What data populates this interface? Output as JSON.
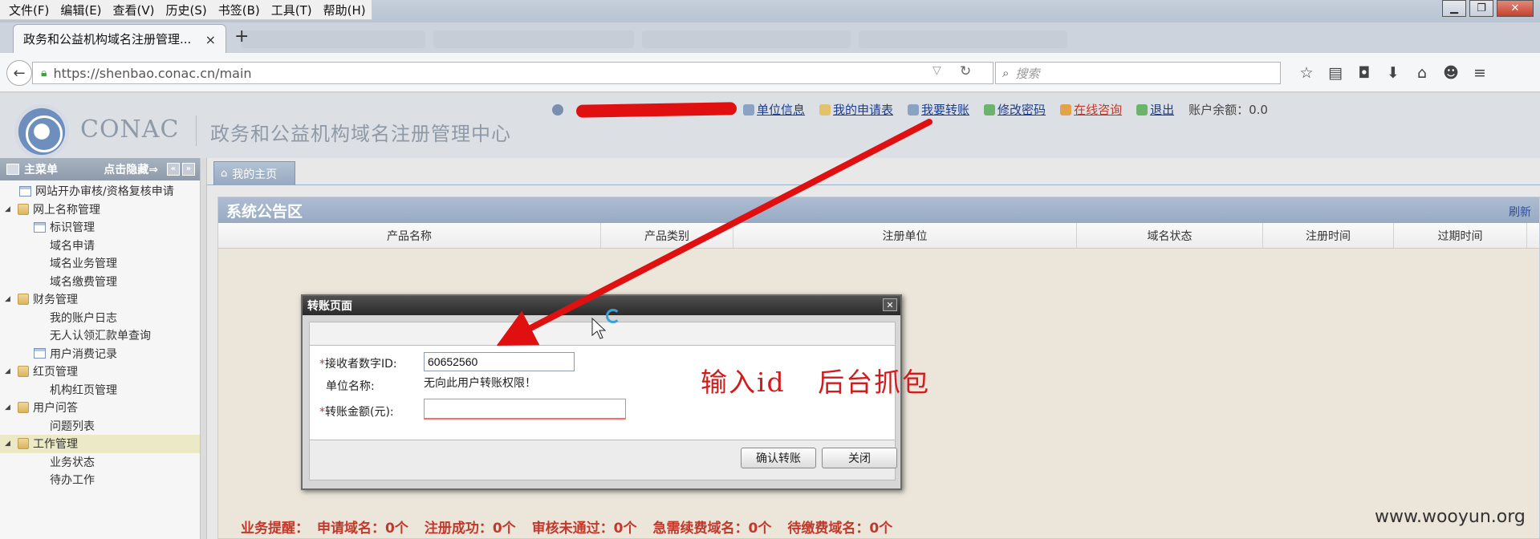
{
  "browser": {
    "menu": [
      "文件(F)",
      "编辑(E)",
      "查看(V)",
      "历史(S)",
      "书签(B)",
      "工具(T)",
      "帮助(H)"
    ],
    "tab_title": "政务和公益机构域名注册管理...",
    "tab_close": "×",
    "new_tab": "+",
    "url": "https://shenbao.conac.cn/main",
    "search_placeholder": "搜索"
  },
  "header": {
    "brand": "CONAC",
    "title": "政务和公益机构域名注册管理中心",
    "links": [
      "单位信息",
      "我的申请表",
      "我要转账",
      "修改密码",
      "在线咨询",
      "退出"
    ],
    "balance": "账户余额：0.0"
  },
  "sidebar": {
    "title": "主菜单",
    "hide_label": "点击隐藏⇒",
    "items": [
      {
        "label": "网站开办审核/资格复核申请",
        "level": 1,
        "icon": "doc-icon"
      },
      {
        "label": "网上名称管理",
        "level": 0,
        "icon": "folder-icon"
      },
      {
        "label": "标识管理",
        "level": 1,
        "icon": "doc-icon"
      },
      {
        "label": "域名申请",
        "level": 2,
        "icon": ""
      },
      {
        "label": "域名业务管理",
        "level": 2,
        "icon": ""
      },
      {
        "label": "域名缴费管理",
        "level": 2,
        "icon": ""
      },
      {
        "label": "财务管理",
        "level": 0,
        "icon": "folder-icon"
      },
      {
        "label": "我的账户日志",
        "level": 2,
        "icon": ""
      },
      {
        "label": "无人认领汇款单查询",
        "level": 2,
        "icon": ""
      },
      {
        "label": "用户消费记录",
        "level": 1,
        "icon": "doc-icon"
      },
      {
        "label": "红页管理",
        "level": 0,
        "icon": "folder-icon"
      },
      {
        "label": "机构红页管理",
        "level": 2,
        "icon": ""
      },
      {
        "label": "用户问答",
        "level": 0,
        "icon": "folder-icon"
      },
      {
        "label": "问题列表",
        "level": 2,
        "icon": ""
      },
      {
        "label": "工作管理",
        "level": 0,
        "icon": "folder-icon",
        "selected": true
      },
      {
        "label": "业务状态",
        "level": 2,
        "icon": ""
      },
      {
        "label": "待办工作",
        "level": 2,
        "icon": ""
      }
    ]
  },
  "main": {
    "home_tab": "我的主页",
    "panel_title": "系统公告区",
    "refresh": "刷新",
    "columns": [
      "产品名称",
      "产品类别",
      "注册单位",
      "域名状态",
      "注册时间",
      "过期时间"
    ],
    "reminder": [
      "业务提醒：",
      "申请域名：0个",
      "注册成功：0个",
      "审核未通过：0个",
      "急需续费域名：0个",
      "待缴费域名：0个"
    ]
  },
  "dialog": {
    "title": "转账页面",
    "close": "✕",
    "receiver_label": "接收者数字ID:",
    "receiver_value": "60652560",
    "unit_label": "单位名称:",
    "unit_value": "无向此用户转账权限！",
    "amount_label": "转账金额(元):",
    "amount_value": "",
    "confirm_button": "确认转账",
    "close_button": "关闭",
    "required_mark": "*"
  },
  "annotation": {
    "text": "输入id 后台抓包",
    "color": "#d01c1c"
  },
  "watermark": "www.wooyun.org"
}
